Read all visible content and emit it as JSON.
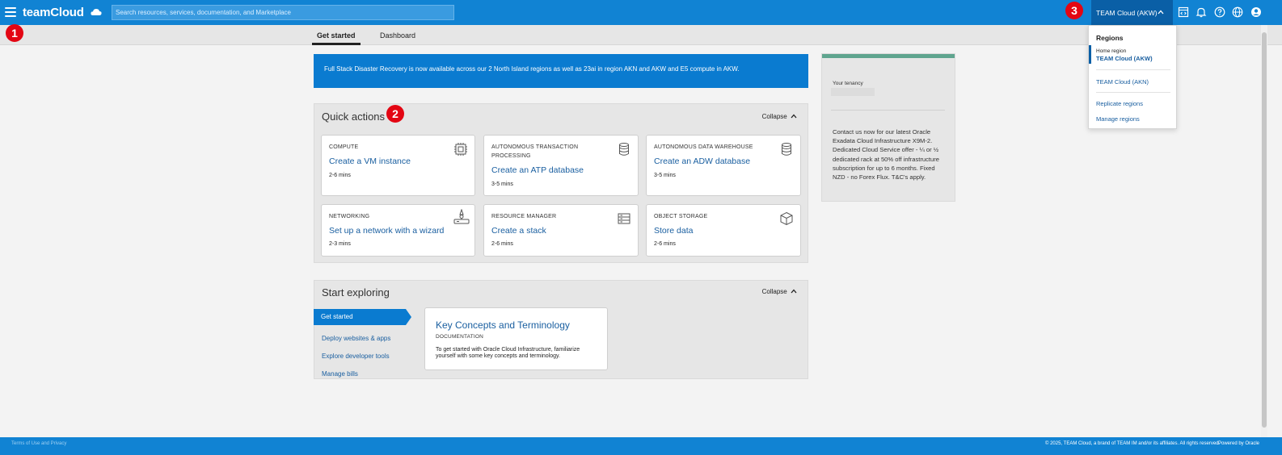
{
  "header": {
    "logo": "teamCloud",
    "search_placeholder": "Search resources, services, documentation, and Marketplace",
    "region_button": "TEAM Cloud (AKW)"
  },
  "badges": [
    "1",
    "2",
    "3"
  ],
  "tabs": [
    "Get started",
    "Dashboard"
  ],
  "banner": "Full Stack Disaster Recovery is now available across our 2 North Island regions as well as 23ai in region AKN and AKW and E5 compute in AKW.",
  "quick_actions": {
    "title": "Quick actions",
    "collapse": "Collapse",
    "cards": [
      {
        "category": "COMPUTE",
        "title": "Create a VM instance",
        "time": "2-6 mins",
        "icon": "cpu-chip-icon"
      },
      {
        "category": "AUTONOMOUS TRANSACTION PROCESSING",
        "title": "Create an ATP database",
        "time": "3-5 mins",
        "icon": "database-icon"
      },
      {
        "category": "AUTONOMOUS DATA WAREHOUSE",
        "title": "Create an ADW database",
        "time": "3-5 mins",
        "icon": "database-icon"
      },
      {
        "category": "NETWORKING",
        "title": "Set up a network with a wizard",
        "time": "2-3 mins",
        "icon": "network-wizard-icon"
      },
      {
        "category": "RESOURCE MANAGER",
        "title": "Create a stack",
        "time": "2-6 mins",
        "icon": "stack-icon"
      },
      {
        "category": "OBJECT STORAGE",
        "title": "Store data",
        "time": "2-6 mins",
        "icon": "storage-box-icon"
      }
    ]
  },
  "start_exploring": {
    "title": "Start exploring",
    "collapse": "Collapse",
    "items": [
      "Get started",
      "Deploy websites & apps",
      "Explore developer tools",
      "Manage bills"
    ],
    "doc": {
      "title": "Key Concepts and Terminology",
      "type": "DOCUMENTATION",
      "text": "To get started with Oracle Cloud Infrastructure, familiarize yourself with some key concepts and terminology."
    }
  },
  "promo": {
    "tenancy_label": "Your tenancy",
    "text": "Contact us now for our latest Oracle Exadata Cloud Infrastructure X9M-2. Dedicated Cloud Service offer - ¼ or ½ dedicated rack at 50% off infrastructure subscription for up to 6 months. Fixed NZD - no Forex Flux. T&C's apply."
  },
  "regions_dropdown": {
    "title": "Regions",
    "home_label": "Home region",
    "home_region": "TEAM Cloud (AKW)",
    "other_region": "TEAM Cloud (AKN)",
    "replicate": "Replicate regions",
    "manage": "Manage regions"
  },
  "footer": {
    "left": "Terms of Use and Privacy",
    "right": "© 2025, TEAM Cloud, a brand of TEAM IM and/or its affiliates. All rights reserved.",
    "powered": "Powered by Oracle"
  },
  "colors": {
    "topbar": "#1183d3",
    "accent": "#0a7bd0",
    "badge": "#e30613",
    "link": "#1a5fa0",
    "promo_accent": "#5fa58f"
  }
}
